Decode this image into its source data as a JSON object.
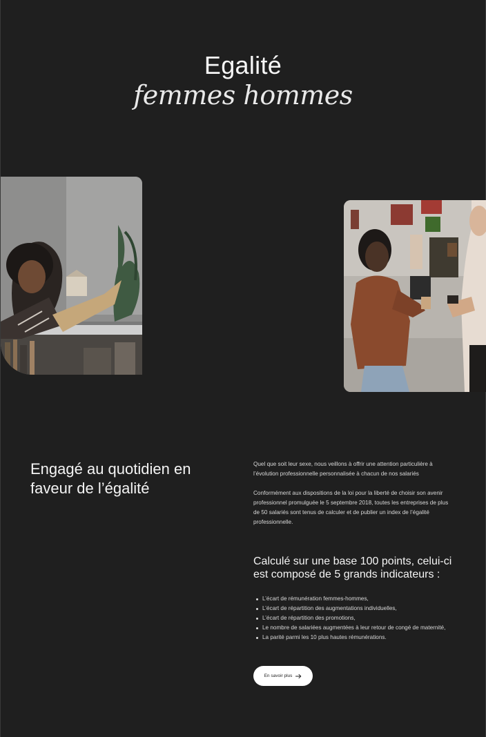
{
  "hero": {
    "title_line1": "Egalité",
    "title_line2": "femmes hommes"
  },
  "images": {
    "left_alt": "Femme souriante tenant une maquette en bois",
    "right_alt": "Collègues discutant devant un mur d’inspiration"
  },
  "section": {
    "heading": "Engagé au quotidien en faveur de l’égalité",
    "paragraph_1": "Quel que soit leur sexe, nous veillons à offrir une attention particulière à l’évolution professionnelle personnalisée à chacun de nos salariés",
    "paragraph_2": "Conformément aux dispositions de la loi pour la liberté de choisir son avenir professionnel promulguée le 5 septembre 2018, toutes les entreprises de plus de 50 salariés sont tenus de calculer et de publier un index de l’égalité professionnelle.",
    "subheading": "Calculé sur une base 100 points, celui-ci est composé de 5 grands indicateurs :",
    "indicators": [
      "L’écart de rémunération femmes-hommes,",
      "L’écart de répartition des augmentations individuelles,",
      "L’écart de répartition des promotions,",
      "Le nombre de salariées augmentées à leur retour de congé de maternité,",
      "La parité parmi les 10 plus hautes rémunérations."
    ],
    "cta_label": "En savoir plus",
    "cta_icon": "arrow-right-icon"
  },
  "colors": {
    "background": "#1f1f1f",
    "text": "#f2f2f2",
    "button_bg": "#ffffff"
  }
}
